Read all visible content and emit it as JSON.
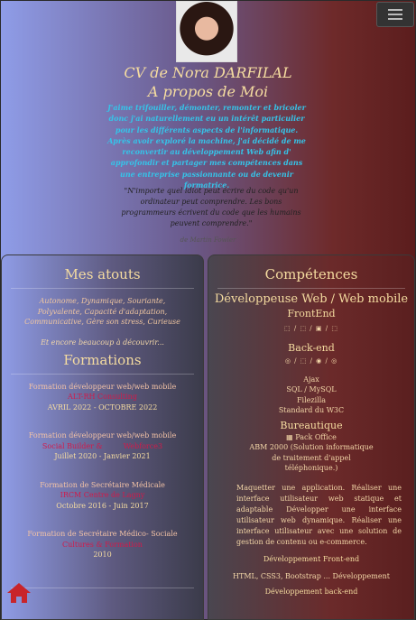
{
  "header": {
    "menu_icon": "hamburger-icon",
    "title_line1": "CV de Nora DARFILAL",
    "title_line2": "A propos de Moi",
    "about": "J'aime trifouiller, démonter, remonter et bricoler donc j'ai naturellement eu un intérêt particulier pour les différents aspects de l'informatique. Après avoir exploré la machine, j'ai décidé de me reconvertir au développement Web afin d' approfondir et partager mes compétences dans une entreprise passionnante ou de devenir formatrice.",
    "quote": "\"N'importe quel idiot peut écrire du code qu'un ordinateur peut comprendre. Les bons programmeurs écrivent du code que les humains peuvent comprendre.\"",
    "quote_author": "de Martin Fowler"
  },
  "left": {
    "atouts_title": "Mes atouts",
    "atouts_text": "Autonome, Dynamique, Souriante, Polyvalente, Capacité d'adaptation, Communicative, Gère son stress, Curieuse",
    "more": "Et encore beaucoup à découvrir...",
    "formations_title": "Formations",
    "formations": [
      {
        "title": "Formation développeur web/web mobile",
        "org": "ALT-RH Consulting",
        "date": "AVRIL 2022 - OCTOBRE 2022"
      },
      {
        "title": "Formation développeur web/web mobile",
        "org": "Social Builder &",
        "org2": "Webforce3",
        "date": "Juillet 2020 - Janvier 2021"
      },
      {
        "title": "Formation de Secrétaire Médicale",
        "org": "IRCM Centre de Lagny",
        "date": "Octobre 2016 - Juin 2017"
      },
      {
        "title": "Formation de Secrétaire Médico- Sociale",
        "org": "Cultures & Formation",
        "date": "2010"
      }
    ],
    "home_icon": "home-icon"
  },
  "right": {
    "competences_title": "Compétences",
    "dev_title": "Développeuse Web / Web mobile",
    "frontend_title": "FrontEnd",
    "frontend_icons": "⬚ / ⬚ / ▣ / ⬚",
    "backend_title": "Back-end",
    "backend_icons": "◎ / ⬚ / ◉ / ◎",
    "backend_list": [
      "Ajax",
      "SQL / MySQL",
      "Filezilla",
      "Standard du W3C"
    ],
    "bureautique_title": "Bureautique",
    "bureautique_list": [
      "▦ Pack Office",
      "ABM 2000 (Solution informatique de traitement d'appel téléphonique.)"
    ],
    "desc": "Maquetter une application. Réaliser une interface utilisateur web statique et adaptable Développer une interface utilisateur web dynamique. Réaliser une interface utilisateur avec une solution de gestion de contenu ou e-commerce.",
    "frontend_dev": "Développement Front-end",
    "frontend_stack": "HTML, CSS3, Bootstrap ... Développement",
    "backend_dev": "Développement back-end"
  }
}
